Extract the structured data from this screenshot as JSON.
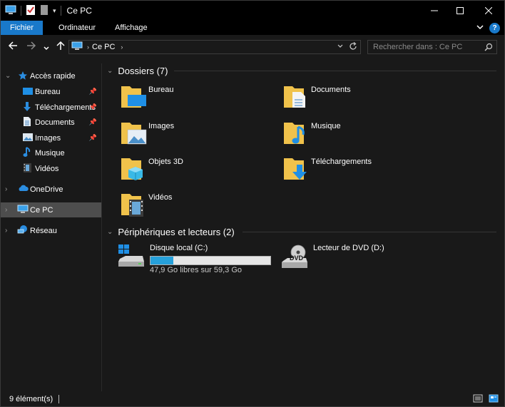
{
  "window": {
    "title": "Ce PC"
  },
  "ribbon": {
    "tabs": [
      {
        "label": "Fichier",
        "active": true
      },
      {
        "label": "Ordinateur"
      },
      {
        "label": "Affichage"
      }
    ],
    "help": "?"
  },
  "navbar": {
    "breadcrumb": "Ce PC",
    "search_placeholder": "Rechercher dans : Ce PC"
  },
  "sidebar": {
    "quick_access": "Accès rapide",
    "items": [
      {
        "label": "Bureau",
        "pinned": true
      },
      {
        "label": "Téléchargements",
        "pinned": true
      },
      {
        "label": "Documents",
        "pinned": true
      },
      {
        "label": "Images",
        "pinned": true
      },
      {
        "label": "Musique",
        "pinned": false
      },
      {
        "label": "Vidéos",
        "pinned": false
      }
    ],
    "onedrive": "OneDrive",
    "this_pc": "Ce PC",
    "network": "Réseau"
  },
  "content": {
    "folders_header": "Dossiers (7)",
    "folders": [
      {
        "label": "Bureau"
      },
      {
        "label": "Documents"
      },
      {
        "label": "Images"
      },
      {
        "label": "Musique"
      },
      {
        "label": "Objets 3D"
      },
      {
        "label": "Téléchargements"
      },
      {
        "label": "Vidéos"
      }
    ],
    "devices_header": "Périphériques et lecteurs (2)",
    "drives": [
      {
        "label": "Disque local (C:)",
        "usage_text": "47,9 Go libres sur 59,3 Go",
        "used_fraction": 0.19
      },
      {
        "label": "Lecteur de DVD (D:)",
        "icon_text": "DVD"
      }
    ]
  },
  "status": {
    "items_count": "9 élément(s)"
  },
  "colors": {
    "accent": "#1979ca",
    "folder": "#f0c24b",
    "drive_fill": "#26a0da"
  }
}
